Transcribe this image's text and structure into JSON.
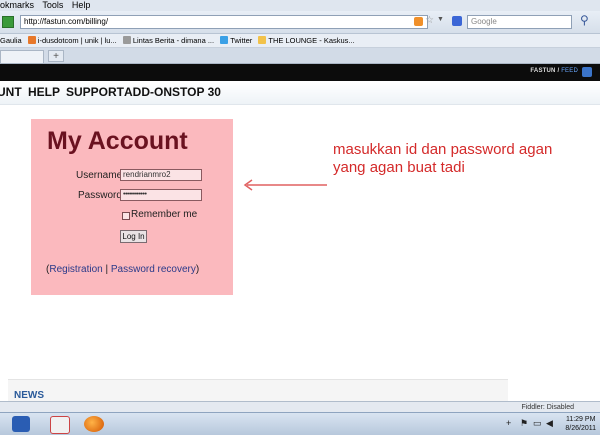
{
  "menu": {
    "items": [
      "okmarks",
      "Tools",
      "Help"
    ]
  },
  "nav": {
    "url": "http://fastun.com/billing/",
    "search_placeholder": "Google"
  },
  "bookmarks": [
    "Gaulia",
    "i-dusdotcom | unik | lu...",
    "Lintas Berita - dimana ...",
    "Twitter",
    "THE LOUNGE - Kaskus..."
  ],
  "newtab_label": "+",
  "site": {
    "brand": "FASTUN",
    "brand_sep": " / ",
    "brand_feed": "FEED",
    "nav": [
      "UNT",
      "HELP",
      "SUPPORT",
      "ADD-ONS",
      "TOP 30"
    ]
  },
  "account": {
    "title": "My Account",
    "username_label": "Username",
    "username_value": "rendrianmro2",
    "password_label": "Password",
    "password_value": "••••••••••••",
    "remember_label": "Remember me",
    "login_label": "Log In",
    "open_paren": "(",
    "registration_link": "Registration",
    "separator": " | ",
    "recovery_link": "Password recovery",
    "close_paren": ")"
  },
  "annotation": {
    "line1": "masukkan id dan password agan",
    "line2": "yang agan buat tadi",
    "color": "#d42a2a"
  },
  "news": {
    "title": "NEWS"
  },
  "status": {
    "fiddler": "Fiddler: Disabled"
  },
  "taskbar": {
    "time": "11:29 PM",
    "date": "8/26/2011"
  }
}
